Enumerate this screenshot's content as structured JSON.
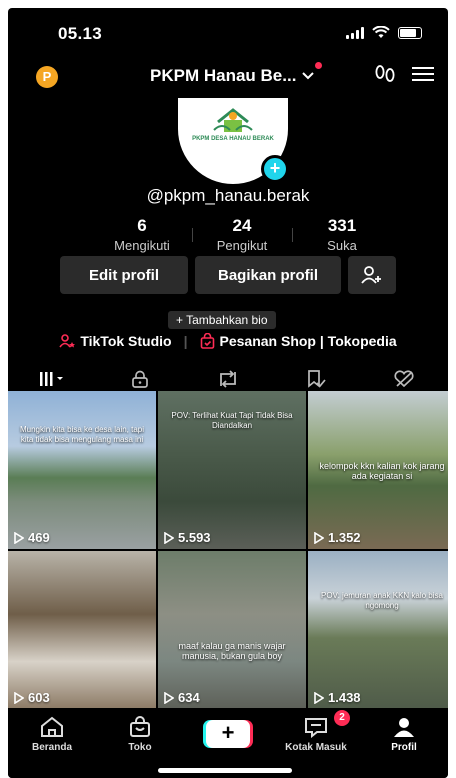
{
  "status_bar": {
    "time": "05.13"
  },
  "header": {
    "coin_label": "P",
    "account_name": "PKPM Hanau Be..."
  },
  "profile": {
    "avatar_caption": "PKPM DESA HANAU BERAK",
    "avatar_subcaption": "",
    "handle": "@pkpm_hanau.berak",
    "stats": [
      {
        "value": "6",
        "label": "Mengikuti"
      },
      {
        "value": "24",
        "label": "Pengikut"
      },
      {
        "value": "331",
        "label": "Suka"
      }
    ],
    "edit_label": "Edit profil",
    "share_label": "Bagikan profil",
    "bio_label": "+ Tambahkan bio",
    "studio_label": "TikTok Studio",
    "shop_label": "Pesanan Shop | Tokopedia"
  },
  "videos": [
    {
      "views": "469",
      "caption": "Mungkin kita bisa ke desa lain, tapi kita tidak bisa mengulang masa ini"
    },
    {
      "views": "5.593",
      "caption": "POV: Terlihat Kuat Tapi Tidak Bisa Diandalkan"
    },
    {
      "views": "1.352",
      "caption": "kelompok kkn kalian kok jarang ada kegiatan si"
    },
    {
      "views": "603",
      "caption": ""
    },
    {
      "views": "634",
      "caption": "maaf kalau ga manis wajar manusia, bukan gula boy"
    },
    {
      "views": "1.438",
      "caption": "POV: jemuran anak KKN kalo bisa ngomong"
    }
  ],
  "nav": {
    "home": "Beranda",
    "shop": "Toko",
    "create": "+",
    "inbox": "Kotak Masuk",
    "inbox_badge": "2",
    "profile": "Profil"
  },
  "colors": {
    "accent_red": "#fe2c55",
    "accent_cyan": "#25f4ee",
    "background": "#000000"
  }
}
